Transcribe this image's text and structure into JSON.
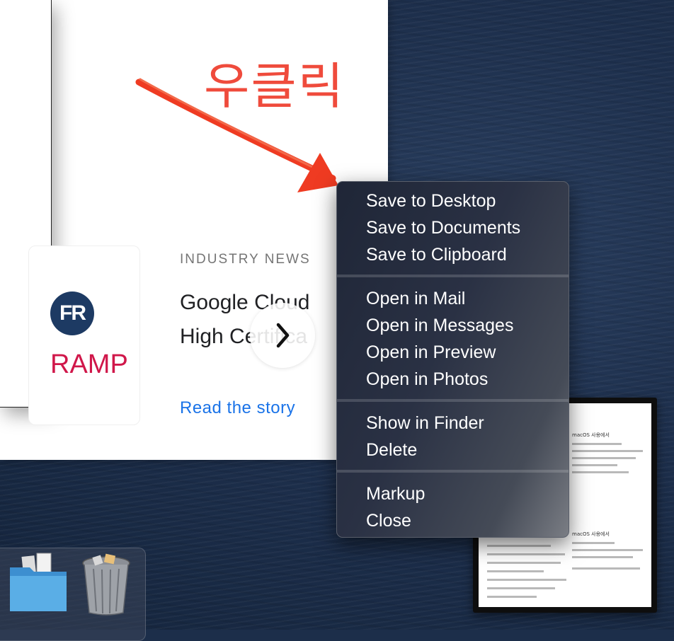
{
  "annotation": {
    "text": "우클릭",
    "color": "#ef4b3c"
  },
  "web_page": {
    "category": "INDUSTRY NEWS",
    "headline_line1": "Google Cloud",
    "headline_line2": "High Certifica",
    "read_story": "Read the story",
    "logo_badge": "FR",
    "logo_text": "RAMP",
    "link_color": "#1a73e8"
  },
  "context_menu": {
    "groups": [
      [
        "Save to Desktop",
        "Save to Documents",
        "Save to Clipboard"
      ],
      [
        "Open in Mail",
        "Open in Messages",
        "Open in Preview",
        "Open in Photos"
      ],
      [
        "Show in Finder",
        "Delete"
      ],
      [
        "Markup",
        "Close"
      ]
    ]
  },
  "thumbnail": {
    "heading1": "macOS 사용에서",
    "heading2": "macOS 사용에서"
  },
  "dock": {
    "items": [
      "folder-icon",
      "trash-icon"
    ]
  }
}
